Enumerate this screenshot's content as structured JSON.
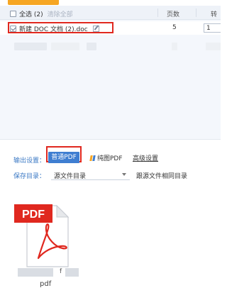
{
  "list": {
    "select_all_label": "全选 (2)",
    "clear_all_label": "清除全部",
    "pages_header": "页数",
    "range_header": "转",
    "files": [
      {
        "name": "新建 DOC 文档 (2).doc",
        "pages": "5",
        "range": "1",
        "checked": true
      }
    ]
  },
  "output": {
    "label": "输出设置：",
    "pdf_button": "普通PDF",
    "image_pdf_button": "纯图PDF",
    "advanced_link": "高级设置"
  },
  "save": {
    "label": "保存目录：",
    "selected": "源文件目录",
    "same_dir_label": "跟源文件相同目录"
  },
  "result_file": {
    "badge": "PDF",
    "caption_fragment": "f",
    "caption_ext": "pdf"
  },
  "colors": {
    "accent_blue": "#3f7ed1",
    "highlight_red": "#e0281f",
    "pdf_red": "#e0281f",
    "orange": "#f6a623"
  }
}
